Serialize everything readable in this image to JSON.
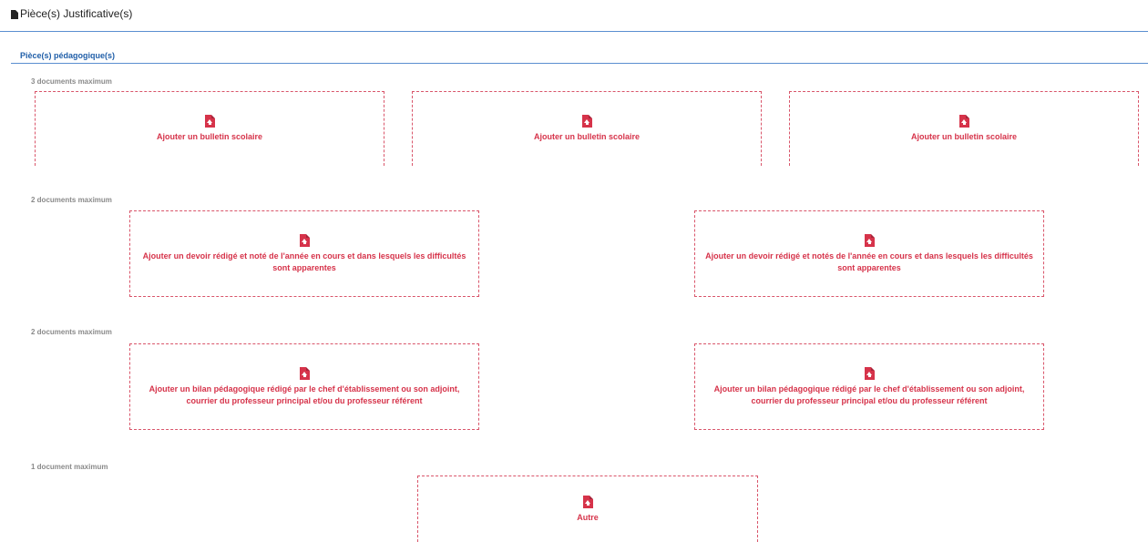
{
  "header": {
    "title": "Pièce(s) Justificative(s)"
  },
  "section": {
    "title": "Pièce(s) pédagogique(s)"
  },
  "groups": [
    {
      "caption": "3 documents maximum",
      "slots": [
        "Ajouter un bulletin scolaire",
        "Ajouter un bulletin scolaire",
        "Ajouter un bulletin scolaire"
      ]
    },
    {
      "caption": "2 documents maximum",
      "slots": [
        "Ajouter un devoir rédigé et noté de l'année en cours et dans lesquels les difficultés sont apparentes",
        "Ajouter un devoir rédigé et notés de l'année en cours et dans lesquels les difficultés sont apparentes"
      ]
    },
    {
      "caption": "2 documents maximum",
      "slots": [
        "Ajouter un bilan pédagogique rédigé par le chef d'établissement ou son adjoint, courrier du professeur principal et/ou du professeur référent",
        "Ajouter un bilan pédagogique rédigé par le chef d'établissement ou son adjoint, courrier du professeur principal et/ou du professeur référent"
      ]
    },
    {
      "caption": "1 document maximum",
      "slots": [
        "Autre"
      ]
    }
  ],
  "colors": {
    "accent": "#d6334a",
    "rule": "#5b8fd0",
    "section_title": "#1f5ea8",
    "caption": "#8a8a8a"
  },
  "icons": {
    "header": "file-icon",
    "slot": "file-upload-icon"
  }
}
